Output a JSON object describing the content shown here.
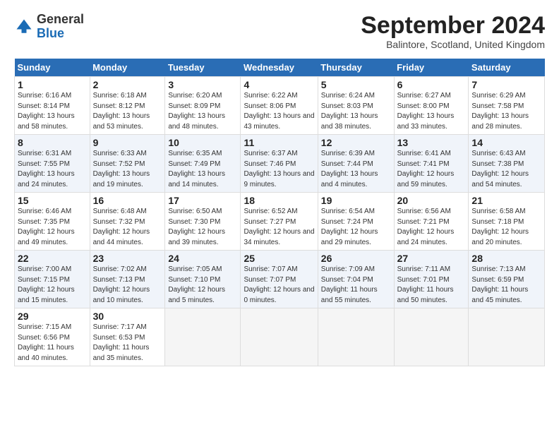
{
  "header": {
    "logo_general": "General",
    "logo_blue": "Blue",
    "month_title": "September 2024",
    "location": "Balintore, Scotland, United Kingdom"
  },
  "days_of_week": [
    "Sunday",
    "Monday",
    "Tuesday",
    "Wednesday",
    "Thursday",
    "Friday",
    "Saturday"
  ],
  "weeks": [
    [
      {
        "num": "1",
        "sunrise": "Sunrise: 6:16 AM",
        "sunset": "Sunset: 8:14 PM",
        "daylight": "Daylight: 13 hours and 58 minutes."
      },
      {
        "num": "2",
        "sunrise": "Sunrise: 6:18 AM",
        "sunset": "Sunset: 8:12 PM",
        "daylight": "Daylight: 13 hours and 53 minutes."
      },
      {
        "num": "3",
        "sunrise": "Sunrise: 6:20 AM",
        "sunset": "Sunset: 8:09 PM",
        "daylight": "Daylight: 13 hours and 48 minutes."
      },
      {
        "num": "4",
        "sunrise": "Sunrise: 6:22 AM",
        "sunset": "Sunset: 8:06 PM",
        "daylight": "Daylight: 13 hours and 43 minutes."
      },
      {
        "num": "5",
        "sunrise": "Sunrise: 6:24 AM",
        "sunset": "Sunset: 8:03 PM",
        "daylight": "Daylight: 13 hours and 38 minutes."
      },
      {
        "num": "6",
        "sunrise": "Sunrise: 6:27 AM",
        "sunset": "Sunset: 8:00 PM",
        "daylight": "Daylight: 13 hours and 33 minutes."
      },
      {
        "num": "7",
        "sunrise": "Sunrise: 6:29 AM",
        "sunset": "Sunset: 7:58 PM",
        "daylight": "Daylight: 13 hours and 28 minutes."
      }
    ],
    [
      {
        "num": "8",
        "sunrise": "Sunrise: 6:31 AM",
        "sunset": "Sunset: 7:55 PM",
        "daylight": "Daylight: 13 hours and 24 minutes."
      },
      {
        "num": "9",
        "sunrise": "Sunrise: 6:33 AM",
        "sunset": "Sunset: 7:52 PM",
        "daylight": "Daylight: 13 hours and 19 minutes."
      },
      {
        "num": "10",
        "sunrise": "Sunrise: 6:35 AM",
        "sunset": "Sunset: 7:49 PM",
        "daylight": "Daylight: 13 hours and 14 minutes."
      },
      {
        "num": "11",
        "sunrise": "Sunrise: 6:37 AM",
        "sunset": "Sunset: 7:46 PM",
        "daylight": "Daylight: 13 hours and 9 minutes."
      },
      {
        "num": "12",
        "sunrise": "Sunrise: 6:39 AM",
        "sunset": "Sunset: 7:44 PM",
        "daylight": "Daylight: 13 hours and 4 minutes."
      },
      {
        "num": "13",
        "sunrise": "Sunrise: 6:41 AM",
        "sunset": "Sunset: 7:41 PM",
        "daylight": "Daylight: 12 hours and 59 minutes."
      },
      {
        "num": "14",
        "sunrise": "Sunrise: 6:43 AM",
        "sunset": "Sunset: 7:38 PM",
        "daylight": "Daylight: 12 hours and 54 minutes."
      }
    ],
    [
      {
        "num": "15",
        "sunrise": "Sunrise: 6:46 AM",
        "sunset": "Sunset: 7:35 PM",
        "daylight": "Daylight: 12 hours and 49 minutes."
      },
      {
        "num": "16",
        "sunrise": "Sunrise: 6:48 AM",
        "sunset": "Sunset: 7:32 PM",
        "daylight": "Daylight: 12 hours and 44 minutes."
      },
      {
        "num": "17",
        "sunrise": "Sunrise: 6:50 AM",
        "sunset": "Sunset: 7:30 PM",
        "daylight": "Daylight: 12 hours and 39 minutes."
      },
      {
        "num": "18",
        "sunrise": "Sunrise: 6:52 AM",
        "sunset": "Sunset: 7:27 PM",
        "daylight": "Daylight: 12 hours and 34 minutes."
      },
      {
        "num": "19",
        "sunrise": "Sunrise: 6:54 AM",
        "sunset": "Sunset: 7:24 PM",
        "daylight": "Daylight: 12 hours and 29 minutes."
      },
      {
        "num": "20",
        "sunrise": "Sunrise: 6:56 AM",
        "sunset": "Sunset: 7:21 PM",
        "daylight": "Daylight: 12 hours and 24 minutes."
      },
      {
        "num": "21",
        "sunrise": "Sunrise: 6:58 AM",
        "sunset": "Sunset: 7:18 PM",
        "daylight": "Daylight: 12 hours and 20 minutes."
      }
    ],
    [
      {
        "num": "22",
        "sunrise": "Sunrise: 7:00 AM",
        "sunset": "Sunset: 7:15 PM",
        "daylight": "Daylight: 12 hours and 15 minutes."
      },
      {
        "num": "23",
        "sunrise": "Sunrise: 7:02 AM",
        "sunset": "Sunset: 7:13 PM",
        "daylight": "Daylight: 12 hours and 10 minutes."
      },
      {
        "num": "24",
        "sunrise": "Sunrise: 7:05 AM",
        "sunset": "Sunset: 7:10 PM",
        "daylight": "Daylight: 12 hours and 5 minutes."
      },
      {
        "num": "25",
        "sunrise": "Sunrise: 7:07 AM",
        "sunset": "Sunset: 7:07 PM",
        "daylight": "Daylight: 12 hours and 0 minutes."
      },
      {
        "num": "26",
        "sunrise": "Sunrise: 7:09 AM",
        "sunset": "Sunset: 7:04 PM",
        "daylight": "Daylight: 11 hours and 55 minutes."
      },
      {
        "num": "27",
        "sunrise": "Sunrise: 7:11 AM",
        "sunset": "Sunset: 7:01 PM",
        "daylight": "Daylight: 11 hours and 50 minutes."
      },
      {
        "num": "28",
        "sunrise": "Sunrise: 7:13 AM",
        "sunset": "Sunset: 6:59 PM",
        "daylight": "Daylight: 11 hours and 45 minutes."
      }
    ],
    [
      {
        "num": "29",
        "sunrise": "Sunrise: 7:15 AM",
        "sunset": "Sunset: 6:56 PM",
        "daylight": "Daylight: 11 hours and 40 minutes."
      },
      {
        "num": "30",
        "sunrise": "Sunrise: 7:17 AM",
        "sunset": "Sunset: 6:53 PM",
        "daylight": "Daylight: 11 hours and 35 minutes."
      },
      null,
      null,
      null,
      null,
      null
    ]
  ]
}
